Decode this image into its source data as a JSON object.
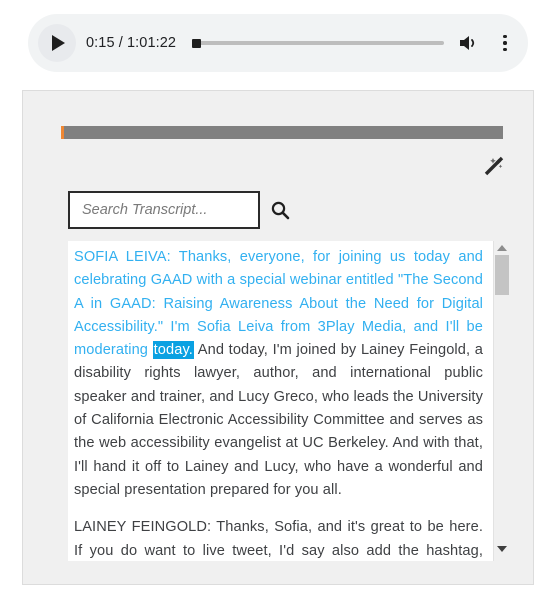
{
  "player": {
    "play_button_label": "Play",
    "play_icon": "play-triangle-icon",
    "time_display": "0:15 / 1:01:22",
    "current_time": "0:15",
    "total_time": "1:01:22",
    "progress_percent": 0,
    "volume_icon": "volume-speaker-icon",
    "menu_icon": "kebab-menu-icon"
  },
  "panel": {
    "progress_bar": {
      "played_percent": 1,
      "played_color": "#ef8733",
      "remaining_color": "#808080"
    },
    "wand_icon": "magic-wand-icon",
    "search": {
      "placeholder": "Search Transcript...",
      "value": "",
      "icon": "search-magnifier-icon"
    },
    "scrollbar": {
      "up_icon": "scroll-up-arrow-icon",
      "down_icon": "scroll-down-arrow-icon",
      "thumb_position_percent": 6
    }
  },
  "transcript": {
    "highlight_color": "#0aa1e2",
    "spoken_color": "#32b0f0",
    "paragraphs": [
      {
        "speaker": "SOFIA LEIVA",
        "spoken_before_highlight": "SOFIA LEIVA: Thanks, everyone, for joining us today and celebrating GAAD with a special webinar entitled \"The Second A in GAAD: Raising Awareness About the Need for Digital Accessibility.\" I'm Sofia Leiva from 3Play Media, and I'll be moderating ",
        "highlighted_word": "today.",
        "after_highlight": " And today, I'm joined by Lainey Feingold, a disability rights lawyer, author, and international public speaker and trainer, and Lucy Greco, who leads the University of California Electronic Accessibility Committee and serves as the web accessibility evangelist at UC Berkeley. And with that, I'll hand it off to Lainey and Lucy, who have a wonderful and special presentation prepared for you all."
      },
      {
        "speaker": "LAINEY FEINGOLD",
        "text": "LAINEY FEINGOLD: Thanks, Sofia, and it's great to be here. If you do want to live tweet, I'd say also add the hashtag, #GAAD capital G capital A capital A capital D going on..."
      }
    ]
  }
}
